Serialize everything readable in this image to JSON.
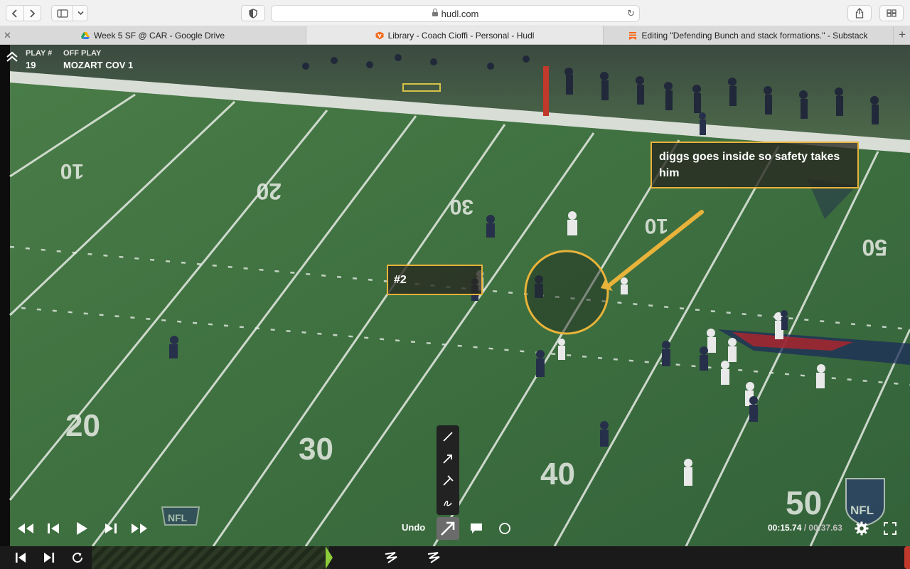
{
  "browser": {
    "url": "hudl.com",
    "tabs": [
      {
        "title": "Week 5 SF @ CAR - Google Drive",
        "icon": "google-drive-icon"
      },
      {
        "title": "Library - Coach Cioffi - Personal - Hudl",
        "icon": "hudl-icon"
      },
      {
        "title": "Editing \"Defending Bunch and stack formations.\" - Substack",
        "icon": "substack-icon"
      }
    ]
  },
  "play": {
    "number_label": "PLAY #",
    "number": "19",
    "off_play_label": "OFF PLAY",
    "off_play": "MOZART COV 1"
  },
  "annotations": {
    "diggs": "diggs goes inside so safety takes him",
    "two": "#2"
  },
  "field": {
    "yard_numbers_left": [
      "10",
      "20",
      "30",
      "40"
    ],
    "yard_numbers_right": [
      "20",
      "30",
      "40",
      "50"
    ],
    "yard_number_mid": "10",
    "yard_number_far_right": "50"
  },
  "watermark": {
    "nfl": "NFL"
  },
  "player": {
    "undo_label": "Undo",
    "current_time": "00:15.74",
    "separator": " / ",
    "total_time": "00:37.63"
  },
  "colors": {
    "annotation": "#e8b33a",
    "timeline_marker": "#8ccc3a",
    "field": "#3c6f3c"
  }
}
